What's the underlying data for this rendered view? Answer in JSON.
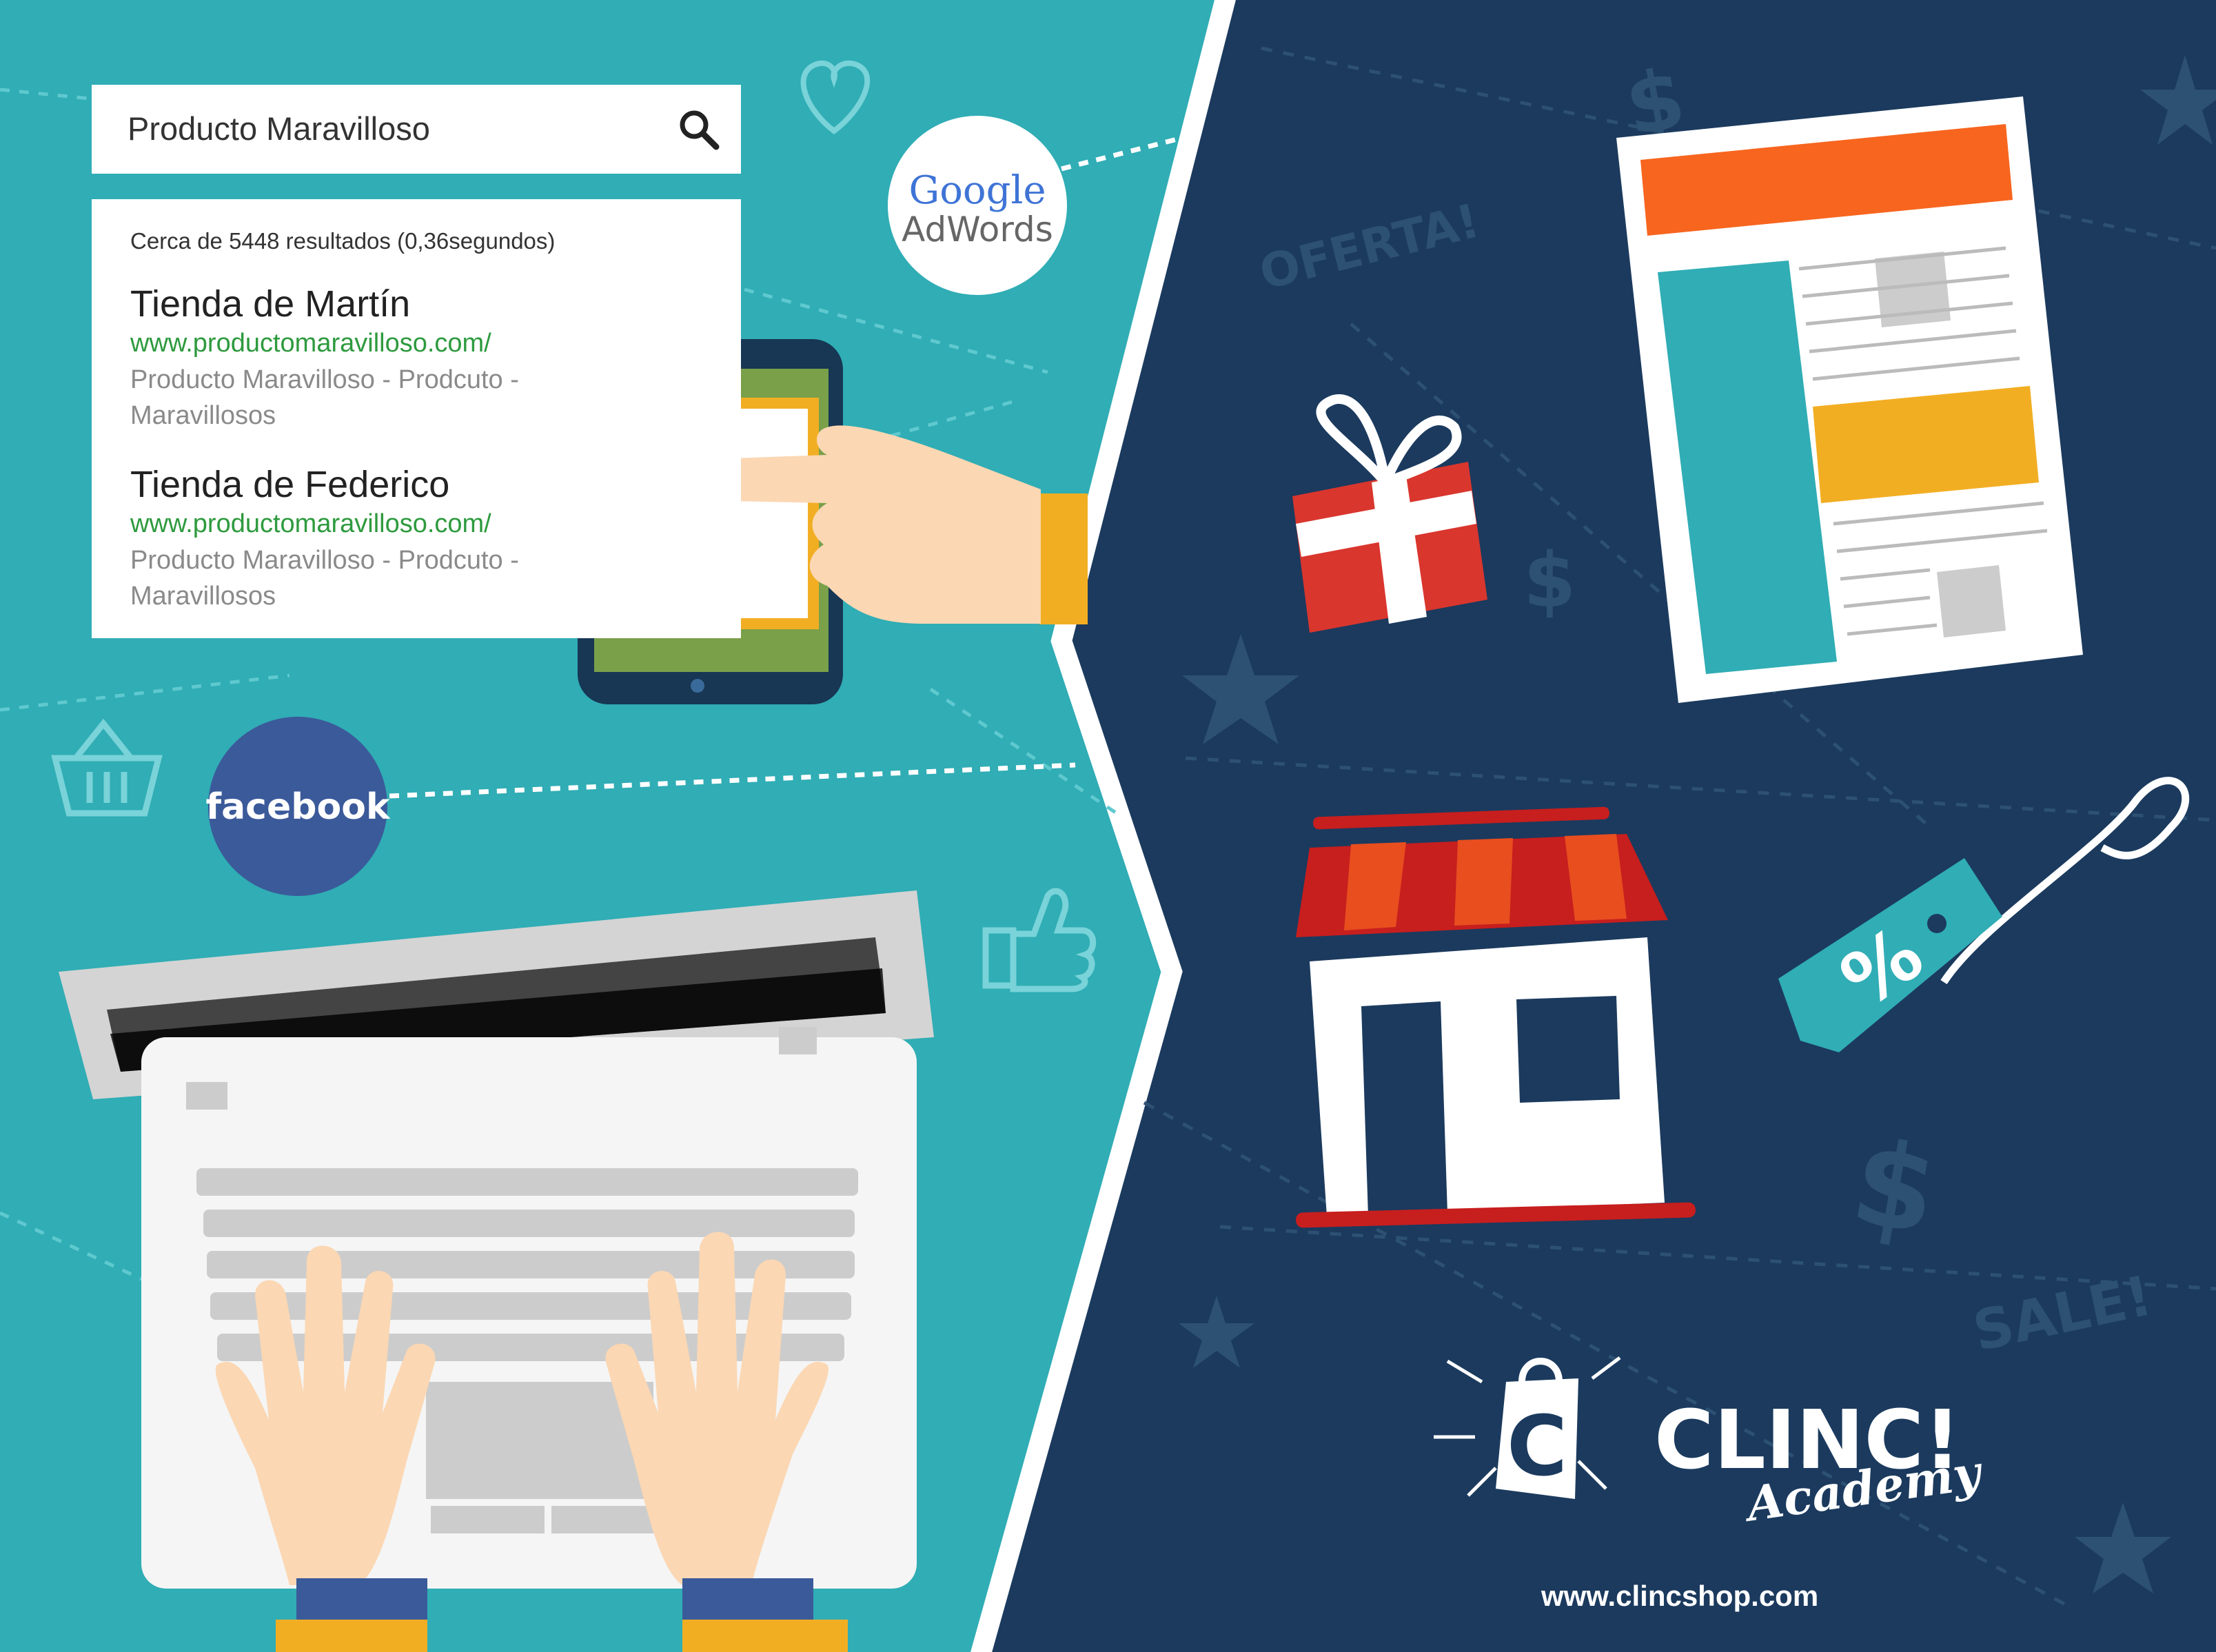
{
  "search": {
    "query": "Producto Maravilloso"
  },
  "results": {
    "count_text": "Cerca de 5448 resultados (0,36segundos)",
    "items": [
      {
        "title": "Tienda de Martín",
        "url": "www.productomaravilloso.com/",
        "description": "Producto Maravilloso - Prodcuto - Maravillosos"
      },
      {
        "title": "Tienda de Federico",
        "url": "www.productomaravilloso.com/",
        "description": "Producto Maravilloso - Prodcuto - Maravillosos"
      }
    ]
  },
  "badges": {
    "google_line1": "Google",
    "google_line2": "AdWords",
    "facebook": "facebook"
  },
  "background_words": {
    "oferta": "OFERTA!",
    "sale": "SALE!"
  },
  "tag": {
    "symbol": "%"
  },
  "brand": {
    "logo_letter": "C",
    "name": "CLINC!",
    "subtitle": "Academy",
    "website": "www.clincshop.com"
  },
  "colors": {
    "left_bg": "#30adb5",
    "right_bg": "#1b3a5e",
    "orange": "#f7651e",
    "yellow": "#f2ae23",
    "red": "#c71e1e",
    "link_green": "#2e9a3e",
    "facebook_blue": "#3b5a9a"
  }
}
